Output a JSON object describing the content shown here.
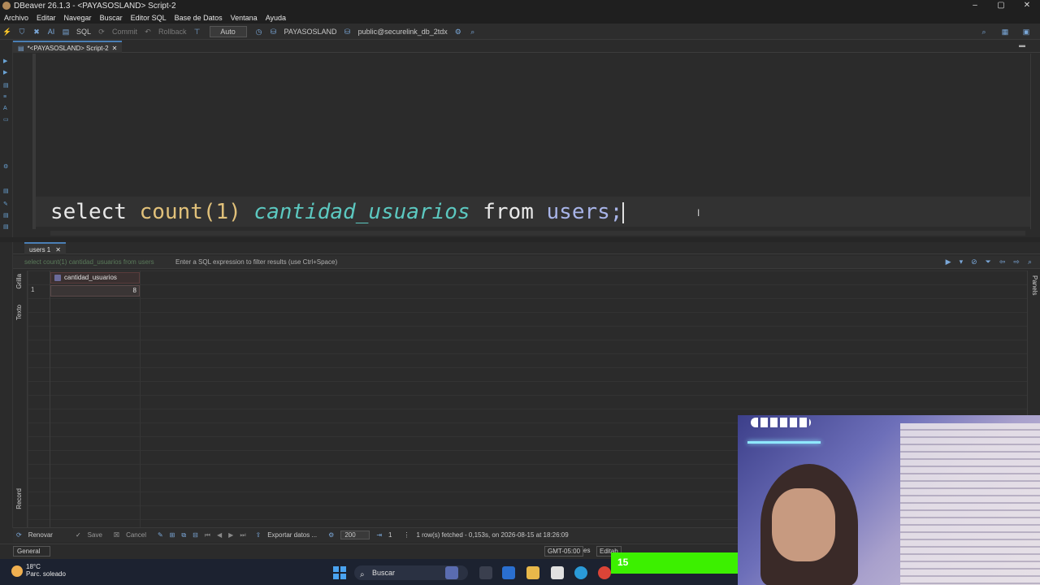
{
  "window": {
    "title": "DBeaver 26.1.3 - <PAYASOSLAND> Script-2",
    "controls": [
      "–",
      "▢",
      "✕"
    ]
  },
  "menu": [
    "Archivo",
    "Editar",
    "Navegar",
    "Buscar",
    "Editor SQL",
    "Base de Datos",
    "Ventana",
    "Ayuda"
  ],
  "toolbar": {
    "sql_label": "SQL",
    "commit_label": "Commit",
    "rollback_label": "Rollback",
    "auto_label": "Auto",
    "datasource": "PAYASOSLAND",
    "schema": "public@securelink_db_2tdx"
  },
  "editor": {
    "tab_label": "*<PAYASOSLAND> Script-2",
    "sql": {
      "kw_select": "select",
      "fn_count": "count(1)",
      "alias": "cantidad_usuarios",
      "kw_from": "from",
      "table": "users;"
    }
  },
  "results": {
    "tab_label": "users 1",
    "filter_query": "select count(1) cantidad_usuarios from users",
    "filter_placeholder": "Enter a SQL expression to filter results (use Ctrl+Space)",
    "side_tabs": [
      "Grilla",
      "Texto",
      "Record"
    ],
    "right_panel_label": "Panels",
    "column": "cantidad_usuarios",
    "rows": [
      {
        "num": "1",
        "value": "8"
      }
    ]
  },
  "statusbar": {
    "renovar": "Renovar",
    "save": "Save",
    "cancel": "Cancel",
    "export": "Exportar datos ...",
    "fetch_size": "200",
    "count": "1",
    "status": "1 row(s) fetched - 0,153s, on 2026-08-15 at 18:26:09"
  },
  "bottombar": {
    "general": "General",
    "timezone": "GMT-05:00",
    "lang": "es",
    "editable": "Editab"
  },
  "taskbar": {
    "temp": "18°C",
    "weather": "Parc. soleado",
    "search": "Buscar"
  },
  "overlay": {
    "counter": "15"
  }
}
